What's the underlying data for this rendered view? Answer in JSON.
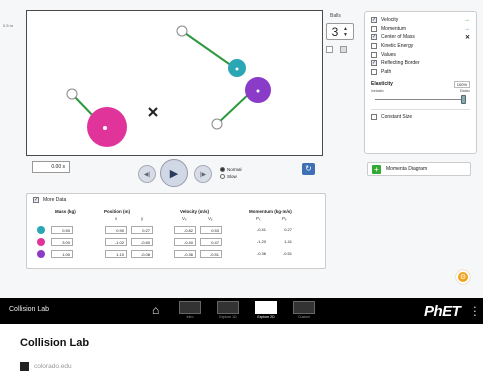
{
  "app": {
    "sim_title": "Collision Lab",
    "scale_label": "0.5 m",
    "balls_label": "Balls",
    "balls_count": "3",
    "options": [
      {
        "label": "Velocity",
        "checked": true,
        "icon": "velocity-arrow-icon"
      },
      {
        "label": "Momentum",
        "checked": false,
        "icon": "momentum-arrow-icon"
      },
      {
        "label": "Center of Mass",
        "checked": true,
        "icon": "center-of-mass-x-icon"
      },
      {
        "label": "Kinetic Energy",
        "checked": false,
        "icon": ""
      },
      {
        "label": "Values",
        "checked": false,
        "icon": ""
      },
      {
        "label": "Reflecting Border",
        "checked": true,
        "icon": ""
      },
      {
        "label": "Path",
        "checked": false,
        "icon": ""
      }
    ],
    "elasticity": {
      "label": "Elasticity",
      "value_text": "100%",
      "min_label": "Inelastic",
      "max_label": "Elastic",
      "value": 1.0
    },
    "constant_size_label": "Constant Size",
    "momenta_diagram_label": "Momenta Diagram",
    "time_value": "0.00 s",
    "speed_options": [
      "Normal",
      "Slow"
    ],
    "speed_selected": "Normal",
    "more_data_label": "More Data",
    "table": {
      "headers": [
        "Mass (kg)",
        "Position (m)",
        "Velocity (m/s)",
        "Momentum (kg·m/s)"
      ],
      "subheaders": [
        "x",
        "y",
        "Vₓ",
        "Vᵧ",
        "Pₓ",
        "Pᵧ"
      ],
      "rows": [
        {
          "color": "#2aa6b5",
          "mass": "0.50",
          "x": "0.90",
          "y": "0.27",
          "vx": "-0.82",
          "vy": "0.53",
          "px": "-0.41",
          "py": "0.27"
        },
        {
          "color": "#e0349b",
          "mass": "3.00",
          "x": "-1.02",
          "y": "-0.60",
          "vx": "-0.40",
          "vy": "0.47",
          "px": "-1.20",
          "py": "1.41"
        },
        {
          "color": "#8a3cc8",
          "mass": "1.00",
          "x": "1.10",
          "y": "-0.08",
          "vx": "-0.36",
          "vy": "-0.51",
          "px": "-0.36",
          "py": "-0.51"
        }
      ]
    }
  },
  "navbar": {
    "title": "Collision Lab",
    "screens": [
      "Intro",
      "Explore 1D",
      "Explore 2D",
      "Custom"
    ],
    "active_screen": "Explore 2D",
    "brand": "PhET"
  },
  "card": {
    "title": "Collision Lab",
    "source": "colorado.edu"
  },
  "colors": {
    "ball_teal": "#2aa6b5",
    "ball_purple": "#8a3cc8",
    "ball_pink": "#e0349b",
    "velocity_arrow": "#2e9a3e",
    "navbar_bg": "#000000"
  }
}
